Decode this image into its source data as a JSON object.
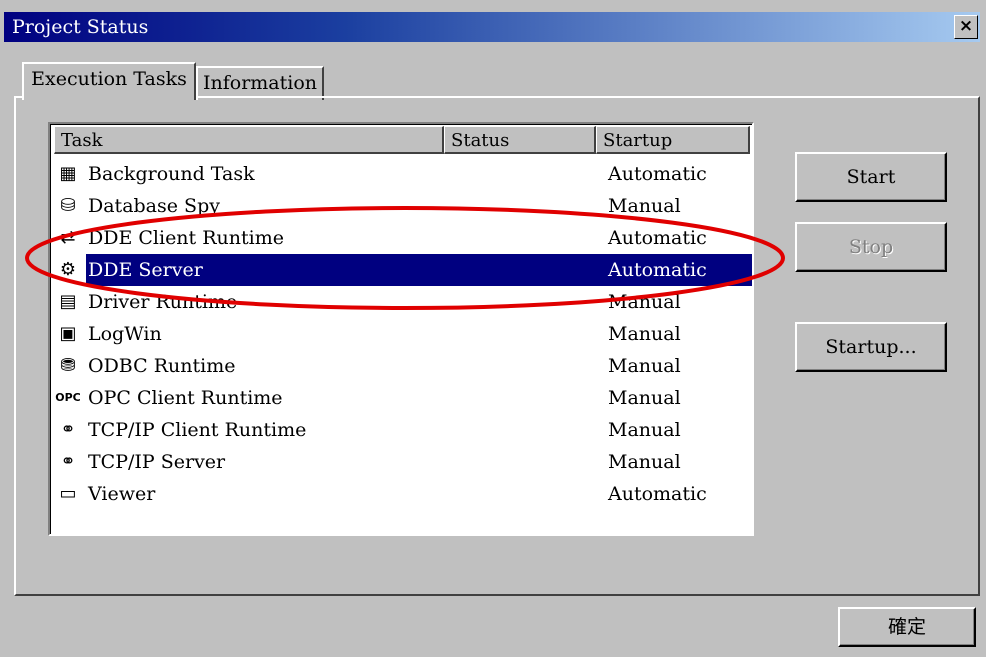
{
  "window": {
    "title": "Project Status",
    "close_label": "×"
  },
  "tabs": [
    {
      "label": "Execution Tasks",
      "active": true
    },
    {
      "label": "Information",
      "active": false
    }
  ],
  "list": {
    "columns": [
      "Task",
      "Status",
      "Startup"
    ],
    "rows": [
      {
        "icon": "background-task-icon",
        "glyph": "▦",
        "name": "Background Task",
        "status": "",
        "startup": "Automatic"
      },
      {
        "icon": "database-spy-icon",
        "glyph": "⛁",
        "name": "Database Spy",
        "status": "",
        "startup": "Manual"
      },
      {
        "icon": "dde-client-icon",
        "glyph": "⇄",
        "name": "DDE Client Runtime",
        "status": "",
        "startup": "Automatic"
      },
      {
        "icon": "dde-server-icon",
        "glyph": "⚙",
        "name": "DDE Server",
        "status": "",
        "startup": "Automatic",
        "selected": true
      },
      {
        "icon": "driver-runtime-icon",
        "glyph": "▤",
        "name": "Driver Runtime",
        "status": "",
        "startup": "Manual"
      },
      {
        "icon": "logwin-icon",
        "glyph": "▣",
        "name": "LogWin",
        "status": "",
        "startup": "Manual"
      },
      {
        "icon": "odbc-runtime-icon",
        "glyph": "⛃",
        "name": "ODBC Runtime",
        "status": "",
        "startup": "Manual"
      },
      {
        "icon": "opc-client-icon",
        "glyph": "OPC",
        "name": "OPC Client Runtime",
        "status": "",
        "startup": "Manual"
      },
      {
        "icon": "tcpip-client-icon",
        "glyph": "⚭",
        "name": "TCP/IP Client Runtime",
        "status": "",
        "startup": "Manual"
      },
      {
        "icon": "tcpip-server-icon",
        "glyph": "⚭",
        "name": "TCP/IP Server",
        "status": "",
        "startup": "Manual"
      },
      {
        "icon": "viewer-icon",
        "glyph": "▭",
        "name": "Viewer",
        "status": "",
        "startup": "Automatic"
      }
    ]
  },
  "buttons": {
    "start": "Start",
    "stop": "Stop",
    "startup": "Startup...",
    "ok": "確定"
  },
  "colors": {
    "selection": "#000080",
    "annotation": "#e00000"
  }
}
